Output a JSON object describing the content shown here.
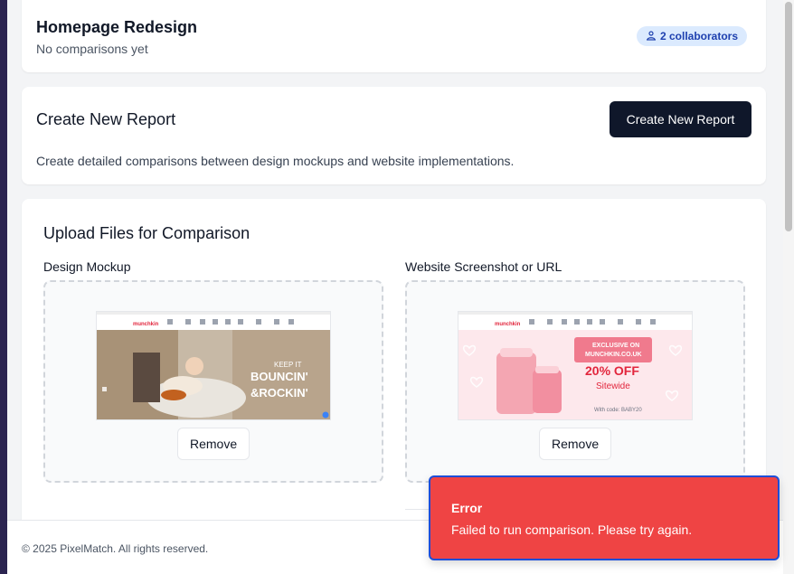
{
  "project": {
    "title": "Homepage Redesign",
    "subtitle": "No comparisons yet",
    "collaborators_badge": "2 collaborators"
  },
  "create_report": {
    "title": "Create New Report",
    "button_label": "Create New Report",
    "description": "Create detailed comparisons between design mockups and website implementations."
  },
  "upload": {
    "title": "Upload Files for Comparison",
    "design": {
      "label": "Design Mockup",
      "remove_label": "Remove",
      "thumb_brand": "munchkin",
      "thumb_headline_1": "KEEP IT",
      "thumb_headline_2": "BOUNCIN'",
      "thumb_headline_3": "&ROCKIN'"
    },
    "website": {
      "label": "Website Screenshot or URL",
      "remove_label": "Remove",
      "thumb_brand": "munchkin",
      "thumb_badge_1": "EXCLUSIVE ON",
      "thumb_badge_2": "MUNCHKIN.CO.UK",
      "thumb_offer": "20% OFF",
      "thumb_offer_sub": "Sitewide",
      "thumb_code": "With code: BABY20"
    }
  },
  "footer": {
    "copyright": "© 2025 PixelMatch. All rights reserved."
  },
  "toast": {
    "title": "Error",
    "message": "Failed to run comparison. Please try again."
  },
  "colors": {
    "primary_button": "#0f172a",
    "badge_bg": "#dbeafe",
    "badge_text": "#1e40af",
    "error": "#ef4444",
    "toast_border": "#1d4ed8"
  }
}
